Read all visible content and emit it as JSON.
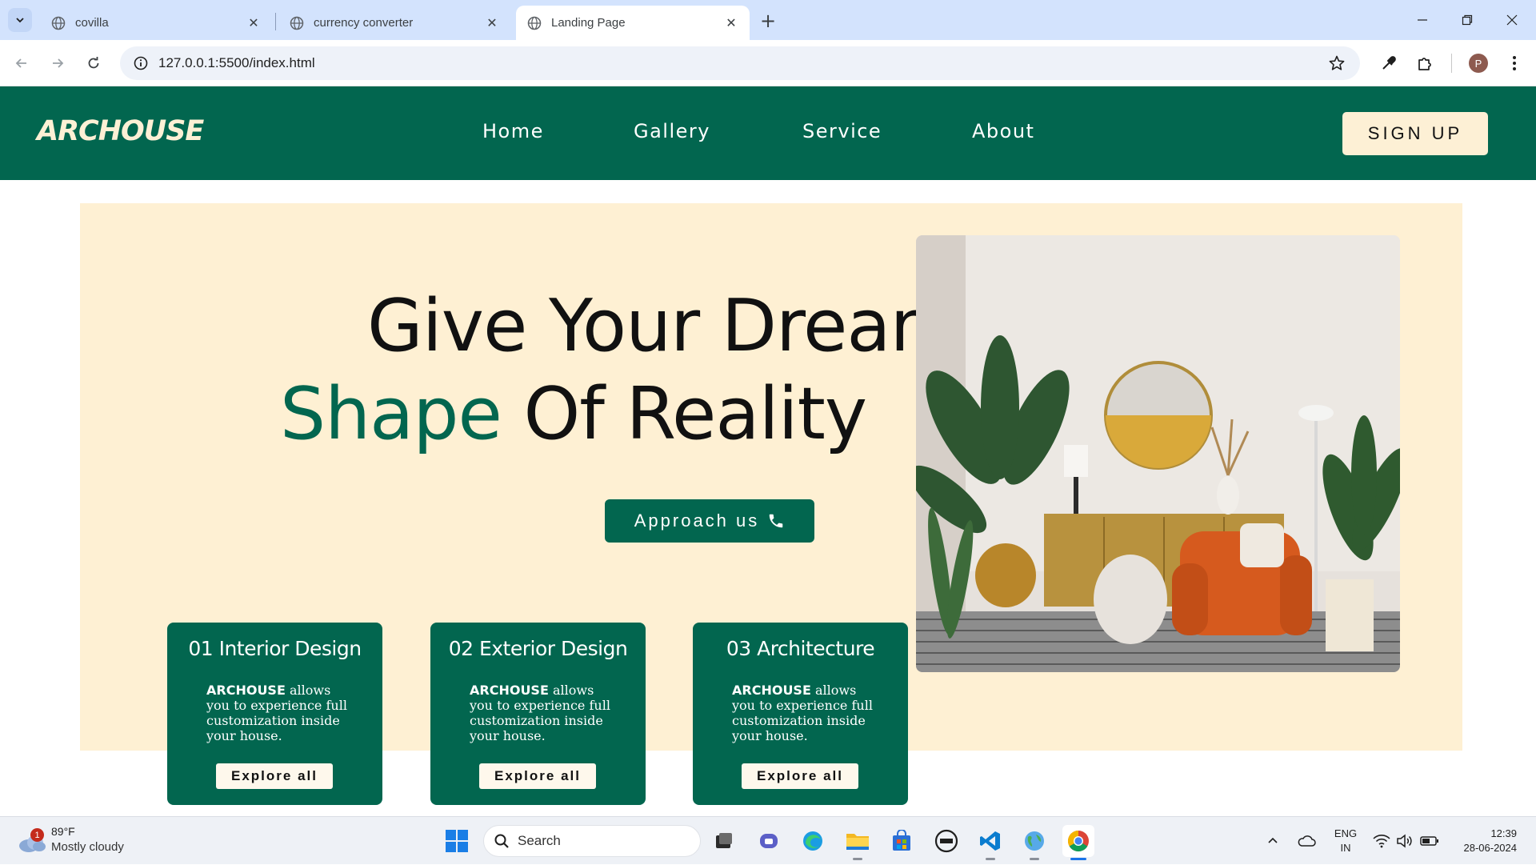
{
  "browser": {
    "tabs": [
      {
        "title": "covilla",
        "active": false
      },
      {
        "title": "currency converter",
        "active": false
      },
      {
        "title": "Landing Page",
        "active": true
      }
    ],
    "url": "127.0.0.1:5500/index.html",
    "profile_initial": "P"
  },
  "site": {
    "logo": "ARCHOUSE",
    "nav": [
      "Home",
      "Gallery",
      "Service",
      "About"
    ],
    "signup_label": "SIGN UP",
    "hero": {
      "line1": "Give Your Dreams",
      "line2_accent": "Shape",
      "line2_rest": "Of Reality",
      "cta_label": "Approach us"
    },
    "cards": [
      {
        "title": "01 Interior Design",
        "brand": "ARCHOUSE",
        "text": "allows you to experience full customization inside your house.",
        "button": "Explore all"
      },
      {
        "title": "02 Exterior Design",
        "brand": "ARCHOUSE",
        "text": "allows you to experience full customization inside your house.",
        "button": "Explore all"
      },
      {
        "title": "03 Architecture",
        "brand": "ARCHOUSE",
        "text": "allows you to experience full customization inside your house.",
        "button": "Explore all"
      }
    ],
    "colors": {
      "primary": "#02664f",
      "cream": "#fef0d3",
      "accent_text": "#02664f"
    }
  },
  "taskbar": {
    "weather": {
      "temp": "89°F",
      "condition": "Mostly cloudy",
      "badge": "1"
    },
    "search_label": "Search",
    "lang_line1": "ENG",
    "lang_line2": "IN",
    "time": "12:39",
    "date": "28-06-2024"
  }
}
